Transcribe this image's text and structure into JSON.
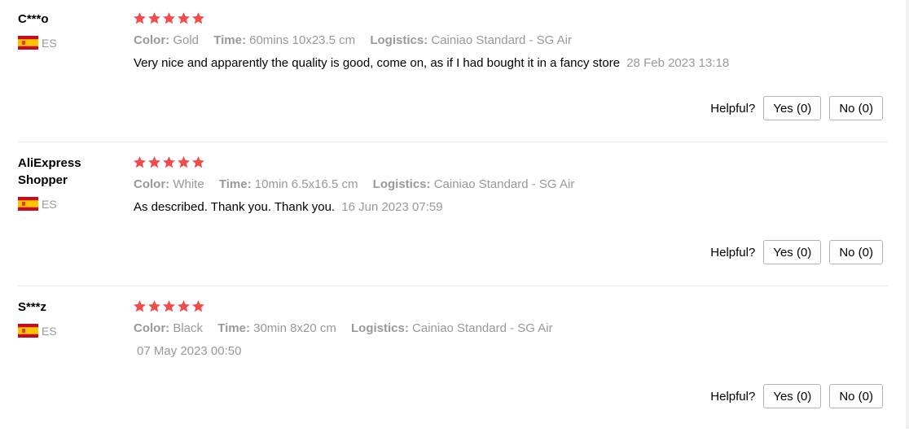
{
  "helpful_label": "Helpful?",
  "star_color": "#f24b4b",
  "reviews": [
    {
      "user": "C***o",
      "country": "ES",
      "rating": 5,
      "color_label": "Color:",
      "color": "Gold",
      "time_label": "Time:",
      "time": "60mins 10x23.5 cm",
      "logistics_label": "Logistics:",
      "logistics": "Cainiao Standard - SG Air",
      "text": "Very nice and apparently the quality is good, come on, as if I had bought it in a fancy store",
      "date": "28 Feb 2023 13:18",
      "yes": "Yes (0)",
      "no": "No (0)"
    },
    {
      "user": "AliExpress Shopper",
      "country": "ES",
      "rating": 5,
      "color_label": "Color:",
      "color": "White",
      "time_label": "Time:",
      "time": "10min 6.5x16.5 cm",
      "logistics_label": "Logistics:",
      "logistics": "Cainiao Standard - SG Air",
      "text": "As described. Thank you. Thank you.",
      "date": "16 Jun 2023 07:59",
      "yes": "Yes (0)",
      "no": "No (0)"
    },
    {
      "user": "S***z",
      "country": "ES",
      "rating": 5,
      "color_label": "Color:",
      "color": "Black",
      "time_label": "Time:",
      "time": "30min 8x20 cm",
      "logistics_label": "Logistics:",
      "logistics": "Cainiao Standard - SG Air",
      "text": "",
      "date": "07 May 2023 00:50",
      "yes": "Yes (0)",
      "no": "No (0)"
    }
  ]
}
